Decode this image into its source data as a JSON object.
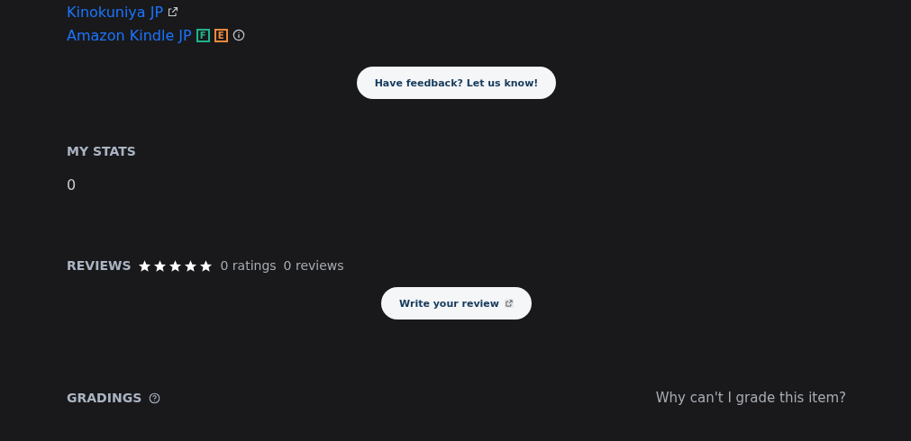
{
  "stores": [
    {
      "name": "Kinokuniya JP"
    },
    {
      "name": "Amazon Kindle JP",
      "badges": [
        {
          "label": "F",
          "color": "#1fb58a"
        },
        {
          "label": "E",
          "color": "#f08a3c"
        }
      ]
    }
  ],
  "feedback_button": "Have feedback? Let us know!",
  "my_stats": {
    "title": "MY STATS",
    "value": "0"
  },
  "reviews": {
    "title": "REVIEWS",
    "stars": 5,
    "ratings": "0 ratings",
    "reviews": "0 reviews",
    "button": "Write your review"
  },
  "gradings": {
    "title": "GRADINGS",
    "link": "Why can't I grade this item?"
  }
}
